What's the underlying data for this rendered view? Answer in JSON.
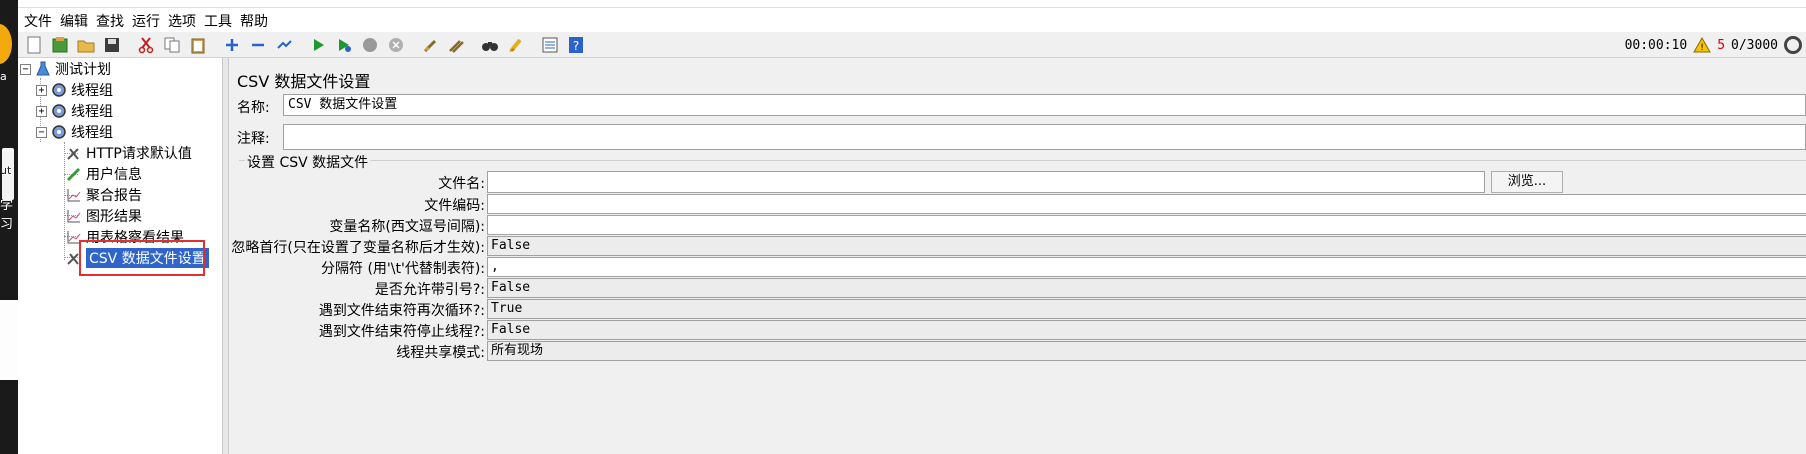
{
  "desktop": {
    "text_a": "a",
    "text_b": "ut",
    "text_c": "学习"
  },
  "menu": [
    "文件",
    "编辑",
    "查找",
    "运行",
    "选项",
    "工具",
    "帮助"
  ],
  "toolbar": {
    "icons": [
      "new-icon",
      "templates-icon",
      "open-icon",
      "save-icon",
      "cut-icon",
      "copy-icon",
      "paste-icon",
      "expand-icon",
      "collapse-icon",
      "toggle-icon",
      "start-icon",
      "start-no-pause-icon",
      "stop-icon",
      "shutdown-icon",
      "clear-icon",
      "clear-all-icon",
      "search-icon",
      "reset-search-icon",
      "function-helper-icon",
      "help-icon"
    ],
    "timer": "00:00:10",
    "warning_count": "5",
    "threads": "0/3000"
  },
  "tree": {
    "root": "测试计划",
    "groups": [
      "线程组",
      "线程组",
      "线程组"
    ],
    "children": [
      "HTTP请求默认值",
      "用户信息",
      "聚合报告",
      "图形结果",
      "用表格察看结果",
      "CSV 数据文件设置"
    ]
  },
  "panel": {
    "title": "CSV 数据文件设置",
    "name_label": "名称:",
    "name_value": "CSV 数据文件设置",
    "comment_label": "注释:",
    "comment_value": "",
    "group_title": "设置 CSV 数据文件",
    "rows": [
      {
        "label": "文件名:",
        "value": ""
      },
      {
        "label": "文件编码:",
        "value": ""
      },
      {
        "label": "变量名称(西文逗号间隔):",
        "value": ""
      },
      {
        "label": "忽略首行(只在设置了变量名称后才生效):",
        "value": "False"
      },
      {
        "label": "分隔符 (用'\\t'代替制表符):",
        "value": ","
      },
      {
        "label": "是否允许带引号?:",
        "value": "False"
      },
      {
        "label": "遇到文件结束符再次循环?:",
        "value": "True"
      },
      {
        "label": "遇到文件结束符停止线程?:",
        "value": "False"
      },
      {
        "label": "线程共享模式:",
        "value": "所有现场"
      }
    ],
    "browse_label": "浏览..."
  }
}
